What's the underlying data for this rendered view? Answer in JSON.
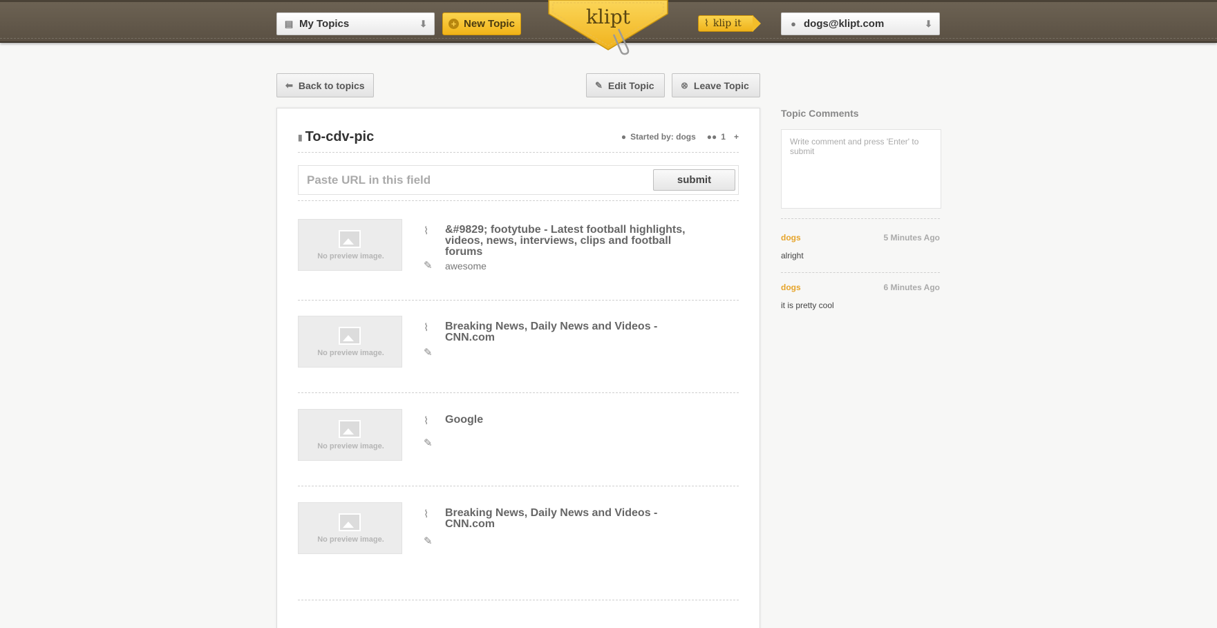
{
  "header": {
    "topics_select": "My Topics",
    "new_topic_label": "New Topic",
    "logo": "klipt",
    "klip_it_label": "klip it",
    "account_select": "dogs@klipt.com"
  },
  "actions": {
    "back_label": "Back to topics",
    "edit_label": "Edit Topic",
    "leave_label": "Leave Topic"
  },
  "topic": {
    "title": "To-cdv-pic",
    "started_by": "Started by: dogs",
    "member_count": "1",
    "add_member": "+",
    "url_placeholder": "Paste URL in this field",
    "submit_label": "submit"
  },
  "items": [
    {
      "title": "&#9829; footytube - Latest football highlights, videos, news, interviews, clips and football forums",
      "note": "awesome",
      "preview": "No preview image."
    },
    {
      "title": "Breaking News, Daily News and Videos - CNN.com",
      "note": "",
      "preview": "No preview image."
    },
    {
      "title": "Google",
      "note": "",
      "preview": "No preview image."
    },
    {
      "title": "Breaking News, Daily News and Videos - CNN.com",
      "note": "",
      "preview": "No preview image."
    }
  ],
  "sidebar": {
    "heading": "Topic Comments",
    "comment_placeholder": "Write comment and press 'Enter' to submit",
    "comments": [
      {
        "author": "dogs",
        "time": "5 Minutes Ago",
        "text": "alright"
      },
      {
        "author": "dogs",
        "time": "6 Minutes Ago",
        "text": "it is pretty cool"
      }
    ]
  },
  "colors": {
    "accent_yellow": "#f2b317",
    "header_brown": "#5f5547",
    "comment_author": "#e6a42a"
  }
}
